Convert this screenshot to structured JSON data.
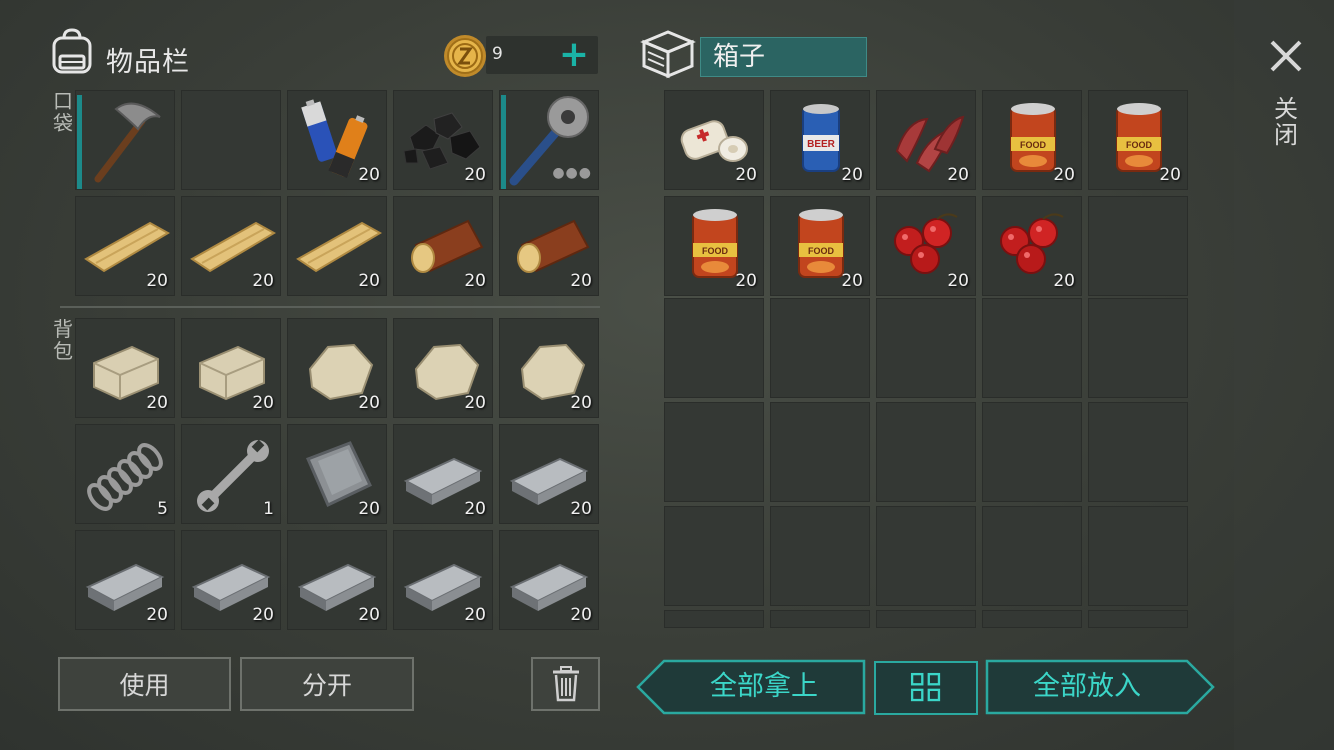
{
  "inventory": {
    "title": "物品栏",
    "coins": "9",
    "pocket_label": "口袋",
    "backpack_label": "背包",
    "pocket_slots": [
      {
        "item": "pickaxe",
        "count": ""
      },
      {
        "item": "empty",
        "count": ""
      },
      {
        "item": "batteries",
        "count": "20"
      },
      {
        "item": "coal",
        "count": "20"
      },
      {
        "item": "spiked-club",
        "count": ""
      },
      {
        "item": "plank",
        "count": "20"
      },
      {
        "item": "plank",
        "count": "20"
      },
      {
        "item": "plank",
        "count": "20"
      },
      {
        "item": "log",
        "count": "20"
      },
      {
        "item": "log",
        "count": "20"
      }
    ],
    "backpack_slots": [
      {
        "item": "stone-block",
        "count": "20"
      },
      {
        "item": "stone-block",
        "count": "20"
      },
      {
        "item": "stone",
        "count": "20"
      },
      {
        "item": "stone",
        "count": "20"
      },
      {
        "item": "stone",
        "count": "20"
      },
      {
        "item": "spring",
        "count": "5"
      },
      {
        "item": "wrench",
        "count": "1"
      },
      {
        "item": "metal-plate",
        "count": "20"
      },
      {
        "item": "iron-ingot",
        "count": "20"
      },
      {
        "item": "iron-ingot",
        "count": "20"
      },
      {
        "item": "iron-ingot",
        "count": "20"
      },
      {
        "item": "iron-ingot",
        "count": "20"
      },
      {
        "item": "iron-ingot",
        "count": "20"
      },
      {
        "item": "iron-ingot",
        "count": "20"
      },
      {
        "item": "iron-ingot",
        "count": "20"
      }
    ]
  },
  "container": {
    "name": "箱子",
    "slots": [
      {
        "item": "bandage",
        "count": "20"
      },
      {
        "item": "beer-can",
        "count": "20"
      },
      {
        "item": "raw-meat",
        "count": "20"
      },
      {
        "item": "food-can",
        "count": "20"
      },
      {
        "item": "food-can",
        "count": "20"
      },
      {
        "item": "food-can",
        "count": "20"
      },
      {
        "item": "food-can",
        "count": "20"
      },
      {
        "item": "berries",
        "count": "20"
      },
      {
        "item": "berries",
        "count": "20"
      },
      {
        "item": "empty",
        "count": ""
      }
    ]
  },
  "close_label": "关闭",
  "buttons": {
    "use": "使用",
    "split": "分开",
    "take_all": "全部拿上",
    "put_all": "全部放入"
  },
  "colors": {
    "accent": "#1ab3a6",
    "slot_bg": "#333733",
    "background": "#3a3e38"
  }
}
